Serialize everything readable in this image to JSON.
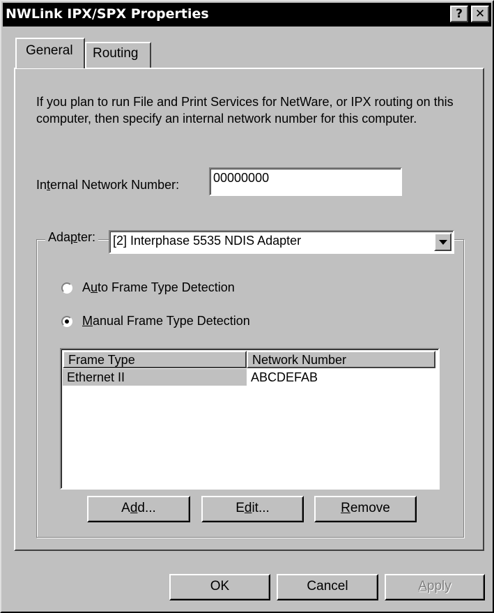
{
  "window": {
    "title": "NWLink IPX/SPX Properties",
    "help_glyph": "?",
    "close_glyph": "✕"
  },
  "tabs": [
    {
      "label": "General"
    },
    {
      "label": "Routing"
    }
  ],
  "general": {
    "description": "If you plan to run File and Print Services for NetWare, or IPX routing on this computer, then specify an internal network number for this computer.",
    "internal_network": {
      "label_pre": "In",
      "label_ul": "t",
      "label_post": "ernal Network Number:",
      "value": "00000000"
    },
    "adapter": {
      "label_pre": "Ada",
      "label_ul": "p",
      "label_post": "ter:",
      "selected": "[2] Interphase 5535 NDIS Adapter"
    },
    "frame_detection": [
      {
        "pre": "A",
        "ul": "u",
        "post": "to Frame Type Detection",
        "checked": false
      },
      {
        "pre": "",
        "ul": "M",
        "post": "anual Frame Type Detection",
        "checked": true
      }
    ],
    "frame_table": {
      "columns": [
        "Frame Type",
        "Network Number"
      ],
      "rows": [
        {
          "frame_type": "Ethernet II",
          "network_number": "ABCDEFAB"
        }
      ]
    },
    "buttons": {
      "add": {
        "pre": "A",
        "ul": "d",
        "post": "d..."
      },
      "edit": {
        "pre": "E",
        "ul": "d",
        "post": "it..."
      },
      "remove": {
        "pre": "",
        "ul": "R",
        "post": "emove"
      }
    }
  },
  "footer": {
    "ok": "OK",
    "cancel": "Cancel",
    "apply_ul": "A",
    "apply_post": "pply"
  }
}
